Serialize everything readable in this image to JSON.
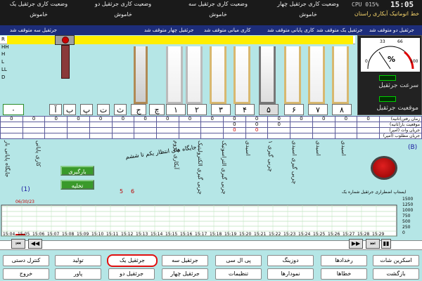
{
  "top": {
    "title": "خط اتوماتیک آبکاری راستان",
    "cpu": "CPU 015%",
    "clock": "15:05",
    "cranes": [
      {
        "name": "وضعیت کاری جرثقیل یک",
        "status": "خاموش"
      },
      {
        "name": "وضعیت کاری جرثقیل دو",
        "status": "خاموش"
      },
      {
        "name": "وضعیت کاری جرثقیل سه",
        "status": "خاموش"
      },
      {
        "name": "وضعیت کاری جرثقیل چهار",
        "status": "خاموش"
      }
    ]
  },
  "statusbar": [
    "جرثقیل دو متوقف شد",
    "جرثقیل یک متوقف شد",
    "کاری پایانی متوقف شد",
    "کاری میانی متوقف شد",
    "جرثقیل چهار متوقف شد",
    "جرثقیل سه متوقف شد"
  ],
  "levels": [
    "R",
    "HH",
    "H",
    "L",
    "LL",
    "D"
  ],
  "stations": [
    "۰",
    "آ",
    "ب",
    "پ",
    "ت",
    "ث",
    "ج",
    "چ",
    "۱",
    "۲",
    "۳",
    "۴",
    "۵",
    "۶",
    "۷",
    "۸"
  ],
  "meter": {
    "ticks": [
      "0",
      "33",
      "66",
      "100"
    ],
    "unit": "%",
    "speed_label": "سرعت جرثقیل",
    "position_label": "موقعیت جرثقیل"
  },
  "table": {
    "row_labels": [
      "زمان رفتن(ثانیه)",
      "موقعیت بار(ثانیه)",
      "جریان وات (آمپر)",
      "جریان مطلوب (آمپر)"
    ],
    "row1_values": [
      "0",
      "0",
      "0",
      "0",
      "0",
      "0",
      "0",
      "0",
      "0",
      "0",
      "0",
      "0",
      "0",
      "0",
      "0",
      "0",
      "0"
    ],
    "row2_values": [
      "0",
      "0",
      "0"
    ],
    "row3_values": [
      "0",
      "0"
    ]
  },
  "loading_station_label": "جایگاه های انتظار یکم تا ششم",
  "load_button": "بارگیری",
  "unload_button": "تخلیه",
  "tank_names": [
    "جایگاه پایانی بار",
    "آبکاری کروم",
    "چربی گیری الکترولیتیک",
    "چربی گیری التراسونیک",
    "اسیدی",
    "چربی گیری ۱",
    "چربی گیری اسیدی",
    "اسیدی",
    "اسیدی"
  ],
  "load_start": "کاری پایانی",
  "left_label": "(1)",
  "right_label": "(B)",
  "counter_a": "5",
  "counter_b": "6",
  "emergency_text": "ایستاپ اضطراری جرثقیل شماره یک",
  "chart": {
    "date": "06/30/23",
    "y_ticks": [
      "1500",
      "1250",
      "1000",
      "750",
      "500",
      "250",
      "0"
    ],
    "times": [
      "15:04",
      "15:05",
      "15:06",
      "15:07",
      "15:08",
      "15:09",
      "15:10",
      "15:11",
      "15:12",
      "15:13",
      "15:14",
      "15:15",
      "15:16",
      "15:17",
      "15:18",
      "15:19",
      "15:20",
      "15:21",
      "15:22",
      "15:23",
      "15:24",
      "15:25",
      "15:26",
      "15:27",
      "15:28",
      "15:29"
    ]
  },
  "buttons": {
    "screenshot": "اسکرین شات",
    "events": "رخدادها",
    "dosing": "دوزینگ",
    "plc": "پی ال سی",
    "crane3": "جرثقیل سه",
    "crane1": "جرثقیل یک",
    "production": "تولید",
    "manual": "کنترل دستی",
    "back": "بازگشت",
    "errors": "خطاها",
    "charts": "نمودارها",
    "settings": "تنظیمات",
    "crane4": "جرثقیل چهار",
    "crane2": "جرثقیل دو",
    "power": "پاور",
    "exit": "خروج"
  }
}
